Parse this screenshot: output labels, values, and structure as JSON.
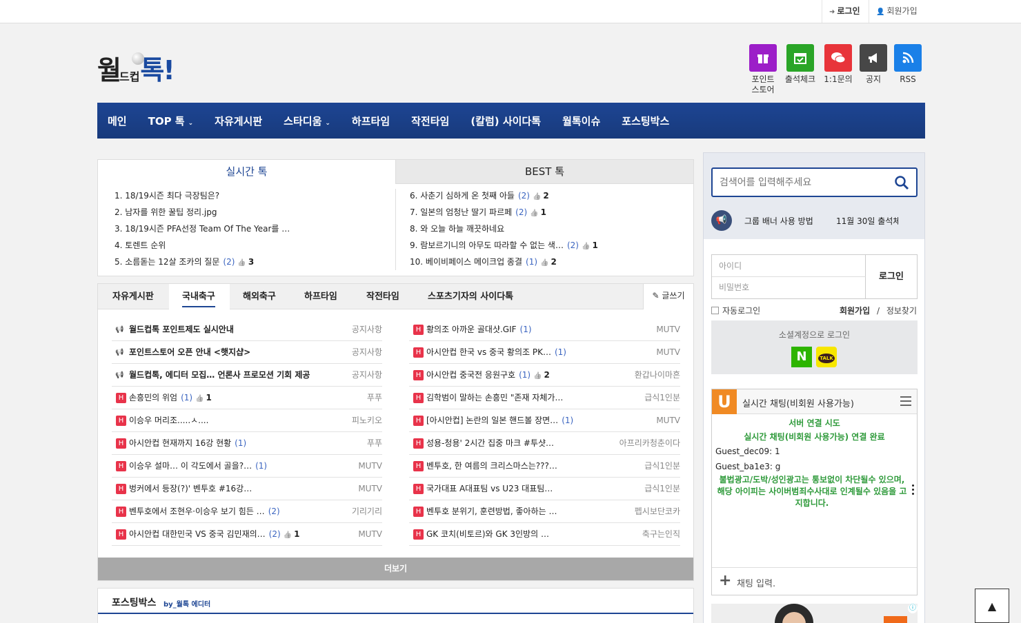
{
  "topbar": {
    "login": "로그인",
    "signup": "회원가입"
  },
  "logo": {
    "part1": "월",
    "part2": "드컵",
    "part3": "톡!"
  },
  "quick_icons": [
    {
      "label": "포인트\n스토어",
      "icon": "gift-icon",
      "color": "#9c1ec8"
    },
    {
      "label": "출석체크",
      "icon": "calendar-check-icon",
      "color": "#2aa527"
    },
    {
      "label": "1:1문의",
      "icon": "chat-bubbles-icon",
      "color": "#e8343a"
    },
    {
      "label": "공지",
      "icon": "megaphone-icon",
      "color": "#474747"
    },
    {
      "label": "RSS",
      "icon": "rss-icon",
      "color": "#1a80e8"
    }
  ],
  "nav": {
    "items": [
      "메인",
      "TOP 톡",
      "자유게시판",
      "스타디움",
      "하프타임",
      "작전타임",
      "(칼럼) 사이다톡",
      "월톡이슈",
      "포스팅박스"
    ]
  },
  "realtime": {
    "tab_live": "실시간 톡",
    "tab_best": "BEST 톡",
    "left": [
      {
        "text": "1. 18/19시즌 최다 극장팀은?",
        "count": "",
        "likes": ""
      },
      {
        "text": "2. 남자를 위한 꿀팁 정리.jpg",
        "count": "",
        "likes": ""
      },
      {
        "text": "3. 18/19시즌 PFA선정 Team Of The Year를 …",
        "count": "",
        "likes": ""
      },
      {
        "text": "4. 토렌트 순위",
        "count": "",
        "likes": ""
      },
      {
        "text": "5. 소름돋는 12살 조카의 질문",
        "count": "(2)",
        "likes": "3"
      }
    ],
    "right": [
      {
        "text": "6. 사춘기 심하게 온 첫째 아들",
        "count": "(2)",
        "likes": "2"
      },
      {
        "text": "7. 일본의 엄청난 딸기 파르페",
        "count": "(2)",
        "likes": "1"
      },
      {
        "text": "8. 와 오늘 하늘 깨끗하네요",
        "count": "",
        "likes": ""
      },
      {
        "text": "9. 람보르기니의 아무도 따라할 수 없는 색…",
        "count": "(2)",
        "likes": "1"
      },
      {
        "text": "10. 베이비페이스 메이크업 종결",
        "count": "(1)",
        "likes": "2"
      }
    ]
  },
  "board": {
    "tabs": [
      "자유게시판",
      "국내축구",
      "해외축구",
      "하프타임",
      "작전타임",
      "스포츠기자의 사이다톡"
    ],
    "write_label": "글쓰기",
    "more_label": "더보기",
    "left": [
      {
        "type": "notice",
        "text": "월드컵톡 포인트제도 실시안내",
        "count": "",
        "likes": "",
        "author": "공지사항"
      },
      {
        "type": "notice",
        "text": "포인트스토어 오픈 안내 <햇지샵>",
        "count": "",
        "likes": "",
        "author": "공지사항"
      },
      {
        "type": "notice",
        "text": "월드컵톡, 에디터 모집… 언론사 프로모션 기회 제공",
        "count": "",
        "likes": "",
        "author": "공지사항"
      },
      {
        "type": "hot",
        "text": "손흥민의 위엄",
        "count": "(1)",
        "likes": "1",
        "author": "푸푸"
      },
      {
        "type": "hot",
        "text": "이승우 머리조.....ㅅ....",
        "count": "",
        "likes": "",
        "author": "피노키오"
      },
      {
        "type": "hot",
        "text": "아시안컵 현재까지 16강 현황",
        "count": "(1)",
        "likes": "",
        "author": "푸푸"
      },
      {
        "type": "hot",
        "text": "이승우 설마… 이 각도에서 골을?…",
        "count": "(1)",
        "likes": "",
        "author": "MUTV"
      },
      {
        "type": "hot",
        "text": "벙커에서 등장(?)' 벤투호 #16강…",
        "count": "",
        "likes": "",
        "author": "MUTV"
      },
      {
        "type": "hot",
        "text": "벤투호에서 조현우·이승우 보기 힘든 …",
        "count": "(2)",
        "likes": "",
        "author": "기리기리"
      },
      {
        "type": "hot",
        "text": "아시안컵 대한민국 VS 중국 김민재의…",
        "count": "(2)",
        "likes": "1",
        "author": "MUTV"
      }
    ],
    "right": [
      {
        "text": "황의조 아까운 골대샷.GIF",
        "count": "(1)",
        "likes": "",
        "author": "MUTV"
      },
      {
        "text": "아시안컵 한국 vs 중국 황의조 PK…",
        "count": "(1)",
        "likes": "",
        "author": "MUTV"
      },
      {
        "text": "아시안컵 중국전 응원구호",
        "count": "(1)",
        "likes": "2",
        "author": "환갑나이마흔"
      },
      {
        "text": "김학범이 말하는 손흥민 \"존재 자체가…",
        "count": "",
        "likes": "",
        "author": "급식1인분"
      },
      {
        "text": "[아시안컵] 논란의 일본 핸드볼 장면…",
        "count": "(1)",
        "likes": "",
        "author": "MUTV"
      },
      {
        "text": "성용-청용' 2시간 집중 마크 #투샷…",
        "count": "",
        "likes": "",
        "author": "아프리카청춘이다"
      },
      {
        "text": "벤투호, 한 여름의 크리스마스는???…",
        "count": "",
        "likes": "",
        "author": "급식1인분"
      },
      {
        "text": "국가대표 A대표팀 vs U23 대표팀…",
        "count": "",
        "likes": "",
        "author": "급식1인분"
      },
      {
        "text": "벤투호 분위기, 훈련방법, 좋아하는 …",
        "count": "",
        "likes": "",
        "author": "펩시보단코카"
      },
      {
        "text": "GK 코치(비토르)와 GK 3인방의 …",
        "count": "",
        "likes": "",
        "author": "축구는인직"
      }
    ]
  },
  "posting": {
    "title": "포스팅박스",
    "by": "by_월톡 에디터"
  },
  "sidebar": {
    "search_placeholder": "검색어를 입력해주세요",
    "notice1": "그룹 배너 사용 방법",
    "notice2": "11월 30일 출석체",
    "id_placeholder": "아이디",
    "pw_placeholder": "비밀번호",
    "login": "로그인",
    "auto_login": "자동로그인",
    "join": "회원가입",
    "sep": "/",
    "find": "정보찾기",
    "social_title": "소셜계정으로 로그인",
    "naver": "N",
    "kakao": "TALK",
    "chat_title": "실시간 채팅(비회원 사용가능)",
    "chat_logo": "U",
    "chat_msgs": {
      "sys1": "서버 연결 시도",
      "sys2": "실시간 채팅(비회원 사용가능) 연결 완료",
      "u1_name": "Guest_dec09:",
      "u1_msg": "1",
      "u2_name": "Guest_ba1e3:",
      "u2_msg": "g",
      "warn": "불법광고/도박/성인광고는 통보없이 차단될수 있으며, 해당 아이피는 사이버범죄수사대로 인계될수 있음을 고지합니다."
    },
    "chat_input": "채팅 입력."
  }
}
